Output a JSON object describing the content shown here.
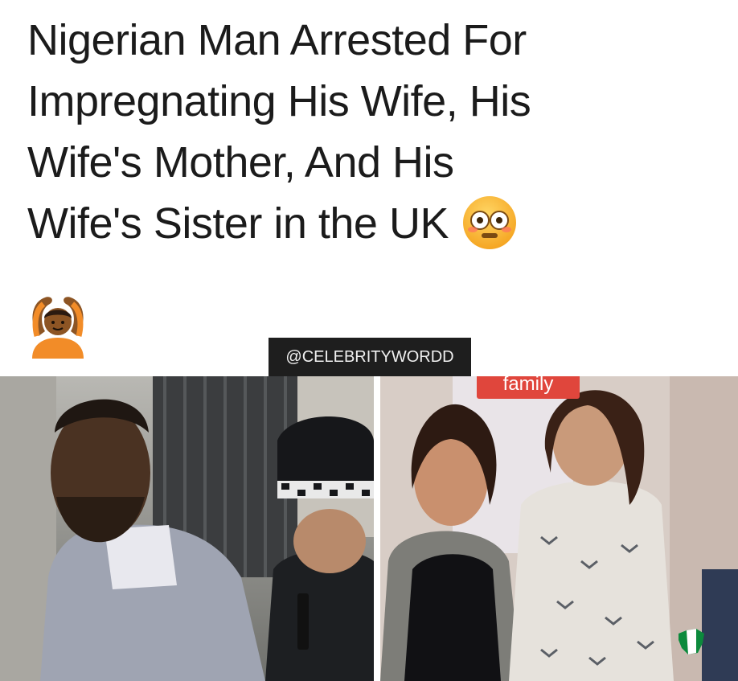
{
  "headline": {
    "line1": "Nigerian Man Arrested For",
    "line2": "Impregnating His Wife, His",
    "line3": "Wife's Mother, And His",
    "line4": "Wife's Sister in the UK"
  },
  "emojis": [
    "flushed-face-emoji",
    "person-gesturing-ok-emoji"
  ],
  "credit": "@CELEBRITYWORDD",
  "photos": {
    "right_label": "family"
  },
  "colors": {
    "headline_text": "#1b1b1b",
    "credit_bg": "#1e1e1e",
    "family_tag": "#e0463c",
    "badge_green": "#0c8a3c"
  }
}
